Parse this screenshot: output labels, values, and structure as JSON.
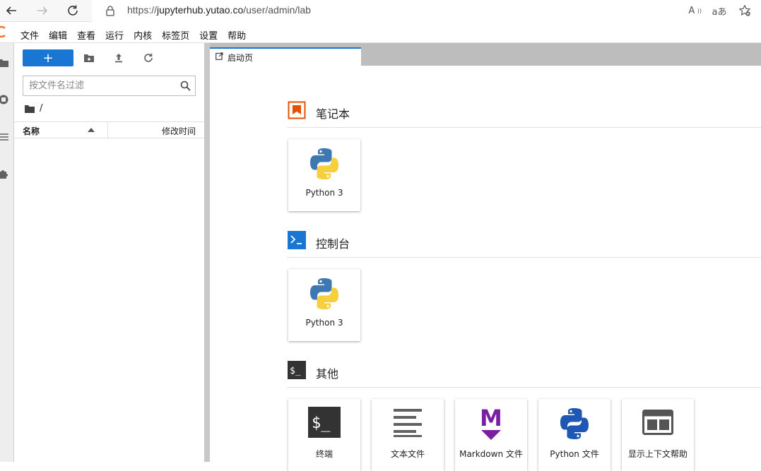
{
  "browser": {
    "url_scheme": "https://",
    "url_host": "jupyterhub.yutao.co",
    "url_path": "/user/admin/lab",
    "read_aloud_label": "A",
    "immersive_label": "aあ"
  },
  "menu": [
    "文件",
    "编辑",
    "查看",
    "运行",
    "内核",
    "标签页",
    "设置",
    "帮助"
  ],
  "filebrowser": {
    "new_label": "+",
    "filter_placeholder": "按文件名过滤",
    "path": "/",
    "col_name": "名称",
    "col_modified": "修改时间"
  },
  "tab": {
    "label": "启动页"
  },
  "launcher": {
    "notebook": {
      "title": "笔记本",
      "cards": [
        "Python 3"
      ]
    },
    "console": {
      "title": "控制台",
      "cards": [
        "Python 3"
      ]
    },
    "other": {
      "title": "其他",
      "cards": [
        "终端",
        "文本文件",
        "Markdown 文件",
        "Python 文件",
        "显示上下文帮助"
      ]
    }
  },
  "colors": {
    "accent": "#1976d2",
    "notebook_icon": "#e65100",
    "console_icon": "#1976d2",
    "other_icon": "#333333",
    "markdown_icon": "#7b1fa2"
  }
}
